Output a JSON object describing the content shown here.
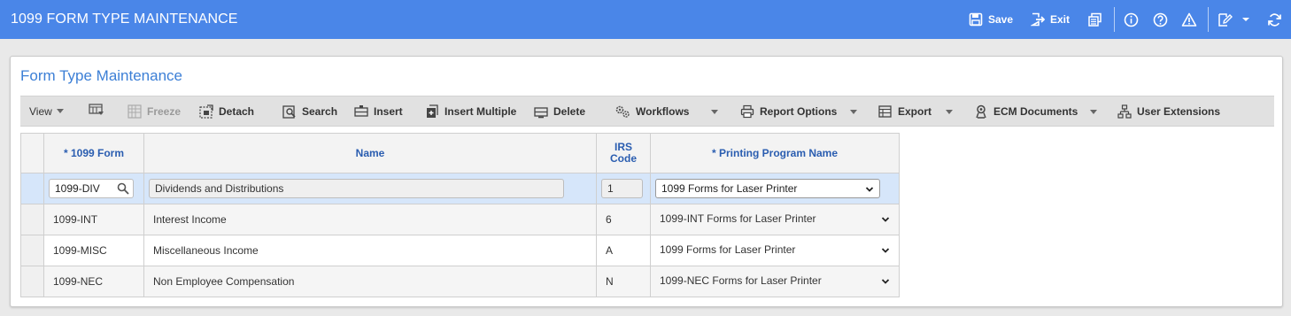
{
  "app": {
    "title": "1099 FORM TYPE MAINTENANCE"
  },
  "titlebar": {
    "save_label": "Save",
    "exit_label": "Exit"
  },
  "panel": {
    "title": "Form Type Maintenance"
  },
  "toolbar": {
    "view_label": "View",
    "freeze_label": "Freeze",
    "detach_label": "Detach",
    "search_label": "Search",
    "insert_label": "Insert",
    "insert_multiple_label": "Insert Multiple",
    "delete_label": "Delete",
    "workflows_label": "Workflows",
    "report_options_label": "Report Options",
    "export_label": "Export",
    "ecm_documents_label": "ECM Documents",
    "user_extensions_label": "User Extensions"
  },
  "grid": {
    "columns": {
      "form": "* 1099 Form",
      "name": "Name",
      "irs_line1": "IRS",
      "irs_line2": "Code",
      "program": "* Printing Program Name"
    },
    "rows": [
      {
        "form": "1099-DIV",
        "name": "Dividends and Distributions",
        "irs": "1",
        "program": "1099 Forms for Laser Printer"
      },
      {
        "form": "1099-INT",
        "name": "Interest Income",
        "irs": "6",
        "program": "1099-INT Forms for Laser Printer"
      },
      {
        "form": "1099-MISC",
        "name": "Miscellaneous Income",
        "irs": "A",
        "program": "1099 Forms for Laser Printer"
      },
      {
        "form": "1099-NEC",
        "name": "Non Employee Compensation",
        "irs": "N",
        "program": "1099-NEC Forms for Laser Printer"
      }
    ]
  },
  "colors": {
    "titlebar": "#4a86e8",
    "panel_title": "#3c7fd6",
    "header_text": "#2a5db0",
    "selected_row": "#d6e6fa"
  },
  "icons": [
    "save-icon",
    "exit-icon",
    "print-icon",
    "info-icon",
    "help-icon",
    "warning-icon",
    "edit-icon",
    "refresh-icon",
    "search-icon",
    "chevron-down-icon"
  ]
}
